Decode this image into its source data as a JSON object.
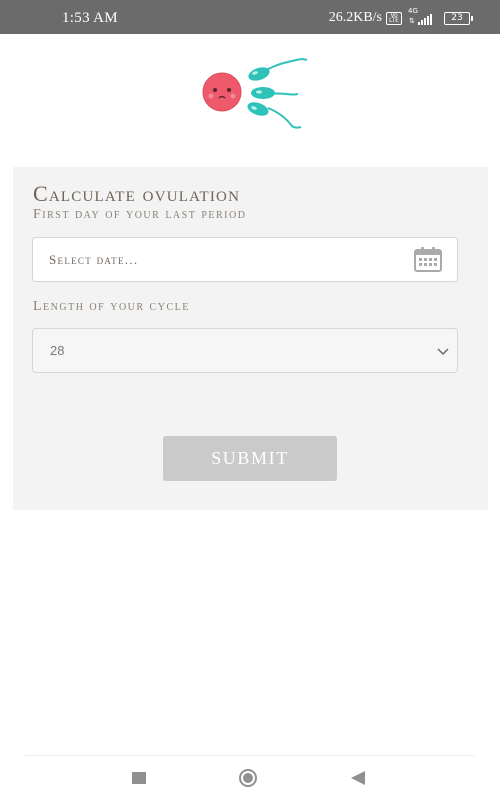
{
  "status_bar": {
    "time": "1:53 AM",
    "net_speed": "26.2KB/s",
    "volte": "Vo LTE",
    "network_type": "4G",
    "battery": "23"
  },
  "app": {
    "logo_icon": "ovulation-egg-sperm-logo"
  },
  "form": {
    "title": "Calculate ovulation",
    "date_label": "First day of your last period",
    "date_placeholder": "Select date...",
    "calendar_icon": "calendar-icon",
    "cycle_label": "Length of your cycle",
    "cycle_value": "28",
    "submit_label": "SUBMIT"
  },
  "colors": {
    "title": "#6e6356",
    "card_bg": "#f3f3f3",
    "submit_bg": "#cacaca",
    "egg": "#ee5a6b",
    "sperm": "#2fc2b9"
  },
  "nav_bar": {
    "recents_icon": "square-icon",
    "home_icon": "circle-icon",
    "back_icon": "triangle-back-icon"
  }
}
